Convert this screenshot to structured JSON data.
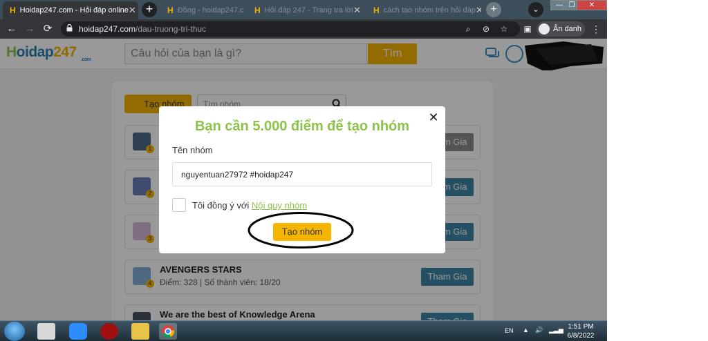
{
  "browser": {
    "tabs": [
      {
        "title": "Hoidap247.com - Hỏi đáp online",
        "state": "active"
      },
      {
        "title": "Đồng - hoidap247.com",
        "state": "inactive"
      },
      {
        "title": "Hỏi đáp 247 - Trang tra lời",
        "state": "inactive"
      },
      {
        "title": "cách tạo nhóm trên hỏi đáp",
        "state": "inactive"
      }
    ],
    "new_tab_label": "+",
    "url_host": "hoidap247.com",
    "url_path": "/dau-truong-tri-thuc",
    "profile_label": "Ẩn danh",
    "window_controls": [
      "—",
      "❐",
      "✕"
    ]
  },
  "site": {
    "logo": {
      "part_h": "H",
      "part_oidap": "oidap",
      "part_num": "247",
      "part_com": ".com"
    },
    "search_placeholder": "Câu hỏi của bạn là gì?",
    "search_button": "Tìm"
  },
  "groups_page": {
    "create_button": "Tạo nhóm",
    "search_placeholder": "Tìm nhóm",
    "groups": [
      {
        "rank": "1",
        "name": "",
        "meta": "",
        "join_label": "Tham Gia",
        "join_state": "grey",
        "thumb": "#4a6a8a"
      },
      {
        "rank": "2",
        "name": "",
        "meta": "",
        "join_label": "Tham Gia",
        "join_state": "blue",
        "thumb": "#6a7fb8"
      },
      {
        "rank": "3",
        "name": "",
        "meta": "",
        "join_label": "Tham Gia",
        "join_state": "blue",
        "thumb": "#d4b7d8"
      },
      {
        "rank": "4",
        "name": "AVENGERS STARS",
        "meta": "Điểm: 328   |   Số thành viên: 18/20",
        "join_label": "Tham Gia",
        "join_state": "blue",
        "thumb": "#7fb0d8"
      },
      {
        "rank": "5",
        "name": "We are the best of Knowledge Arena",
        "meta": "",
        "join_label": "Tham Gia",
        "join_state": "blue",
        "thumb": "#4a5060"
      }
    ]
  },
  "modal": {
    "title": "Bạn cần 5.000 điểm để tạo nhóm",
    "close_label": "✕",
    "field_label": "Tên nhóm",
    "name_value": "nguyentuan27972 #hoidap247",
    "agree_prefix": "Tôi đồng ý với ",
    "agree_link": "Nội quy nhóm",
    "submit_label": "Tạo nhóm"
  },
  "taskbar": {
    "language": "EN",
    "time": "1:51 PM",
    "date": "6/8/2022"
  },
  "colors": {
    "brand_green": "#8bc34a",
    "brand_yellow": "#f4b400",
    "brand_blue": "#2e7fb8",
    "join_blue": "#3f86a6"
  }
}
